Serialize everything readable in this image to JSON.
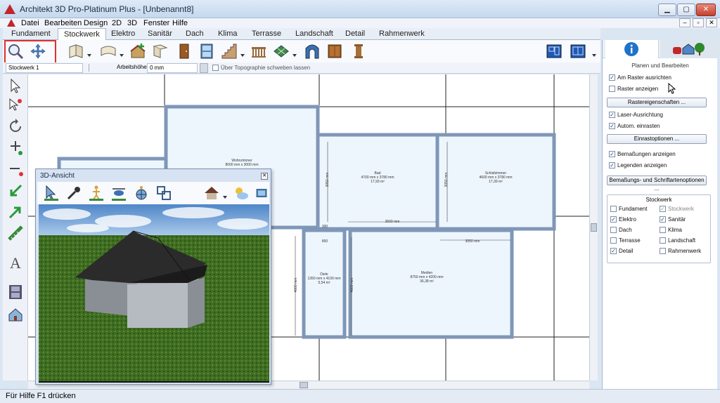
{
  "window": {
    "title": "Architekt 3D Pro-Platinum Plus - [Unbenannt8]",
    "buttons": {
      "minimize": "▁",
      "maximize": "▢",
      "close": "✕"
    }
  },
  "menu": {
    "items": [
      "Datei",
      "Bearbeiten",
      "Design",
      "2D",
      "3D",
      "Fenster",
      "Hilfe"
    ],
    "mdi_buttons": [
      "‒",
      "▫",
      "✕"
    ]
  },
  "tabs": [
    "Fundament",
    "Stockwerk",
    "Elektro",
    "Sanitär",
    "Dach",
    "Klima",
    "Terrasse",
    "Landschaft",
    "Detail",
    "Rahmenwerk"
  ],
  "active_tab": "Stockwerk",
  "toolbar_icons": [
    "zoom-icon",
    "pan-icon",
    "wall-icon",
    "curved-wall-icon",
    "house-plus-icon",
    "room-icon",
    "door-icon",
    "window-icon",
    "stairs-icon",
    "railing-icon",
    "floor-tile-icon",
    "arch-icon",
    "cabinet-icon",
    "column-icon",
    "plan-view-icon",
    "plan-view-2-icon"
  ],
  "optionbar": {
    "floor_select": "Stockwerk 1",
    "height_label": "Arbeitshöhe:",
    "height_value": "0 mm",
    "topo_label": "Über Topographie schweben lassen"
  },
  "plan": {
    "rooms": [
      {
        "name": "Wohnzimmer",
        "dims": "8000 mm x 3000 mm",
        "area": ""
      },
      {
        "name": "Bad",
        "dims": "4700 mm x 3780 mm",
        "area": "17,93 m²"
      },
      {
        "name": "Schlafzimmer",
        "dims": "4600 mm x 3780 mm",
        "area": "17,39 m²"
      },
      {
        "name": "Diele",
        "dims": "1350 mm x 4100 mm",
        "area": "5,54 m²"
      },
      {
        "name": "Medien",
        "dims": "8750 mm x 4200 mm",
        "area": "36,38 m²"
      }
    ],
    "dimensions": [
      "3050 mm",
      "3050 mm",
      "3500 mm",
      "300",
      "800",
      "3050 mm",
      "4000 mm",
      "4000 mm",
      "4000 mm"
    ]
  },
  "view3d": {
    "title": "3D-Ansicht",
    "close": "✕"
  },
  "statusbar": {
    "text": "Für Hilfe F1 drücken"
  },
  "rightpanel": {
    "section_title": "Planen und Bearbeiten",
    "options": [
      {
        "label": "Am Raster ausrichten",
        "checked": true
      },
      {
        "label": "Raster anzeigen",
        "checked": false
      }
    ],
    "btn_grid": "Rastereigenschaften ...",
    "options2": [
      {
        "label": "Laser-Ausrichtung",
        "checked": true
      },
      {
        "label": "Autom. einrasten",
        "checked": true
      }
    ],
    "btn_snap": "Einrastoptionen ...",
    "options3": [
      {
        "label": "Bemaßungen anzeigen",
        "checked": true
      },
      {
        "label": "Legenden anzeigen",
        "checked": true
      }
    ],
    "btn_dim": "Bemaßungs- und Schriftartenoptionen ...",
    "floor_group_title": "Stockwerk",
    "floor_left": [
      {
        "label": "Fundament",
        "checked": false
      },
      {
        "label": "Elektro",
        "checked": true
      },
      {
        "label": "Dach",
        "checked": false
      },
      {
        "label": "Terrasse",
        "checked": false
      },
      {
        "label": "Detail",
        "checked": true
      }
    ],
    "floor_right": [
      {
        "label": "Stockwerk",
        "checked": true
      },
      {
        "label": "Sanitär",
        "checked": true
      },
      {
        "label": "Klima",
        "checked": false
      },
      {
        "label": "Landschaft",
        "checked": false
      },
      {
        "label": "Rahmenwerk",
        "checked": false
      }
    ]
  },
  "colors": {
    "accent": "#2f6fc0",
    "wall": "#8ea5c4",
    "highlight_box": "#e03030"
  }
}
